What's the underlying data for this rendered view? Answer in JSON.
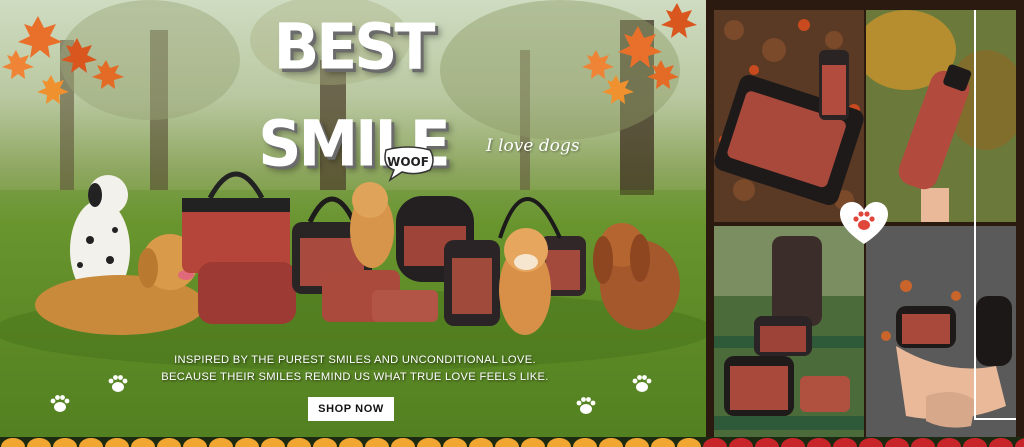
{
  "hero": {
    "title": "BEST SMILE",
    "woof": "WOOF",
    "script_text": "I love dogs",
    "tagline_line1": "INSPIRED BY THE PUREST SMILES AND UNCONDITIONAL LOVE.",
    "tagline_line2": "BECAUSE THEIR SMILES REMIND US WHAT TRUE LOVE FEELS LIKE.",
    "cta_label": "SHOP NOW"
  },
  "icons": {
    "paw": "paw-print-icon",
    "heart": "heart-paw-icon",
    "leaves": "maple-leaf-icon"
  },
  "colors": {
    "accent": "#e0463a",
    "leaf": "#e8702a",
    "cta_bg": "#ffffff",
    "scallop_left": "#f0a630",
    "scallop_right": "#c8252b"
  }
}
